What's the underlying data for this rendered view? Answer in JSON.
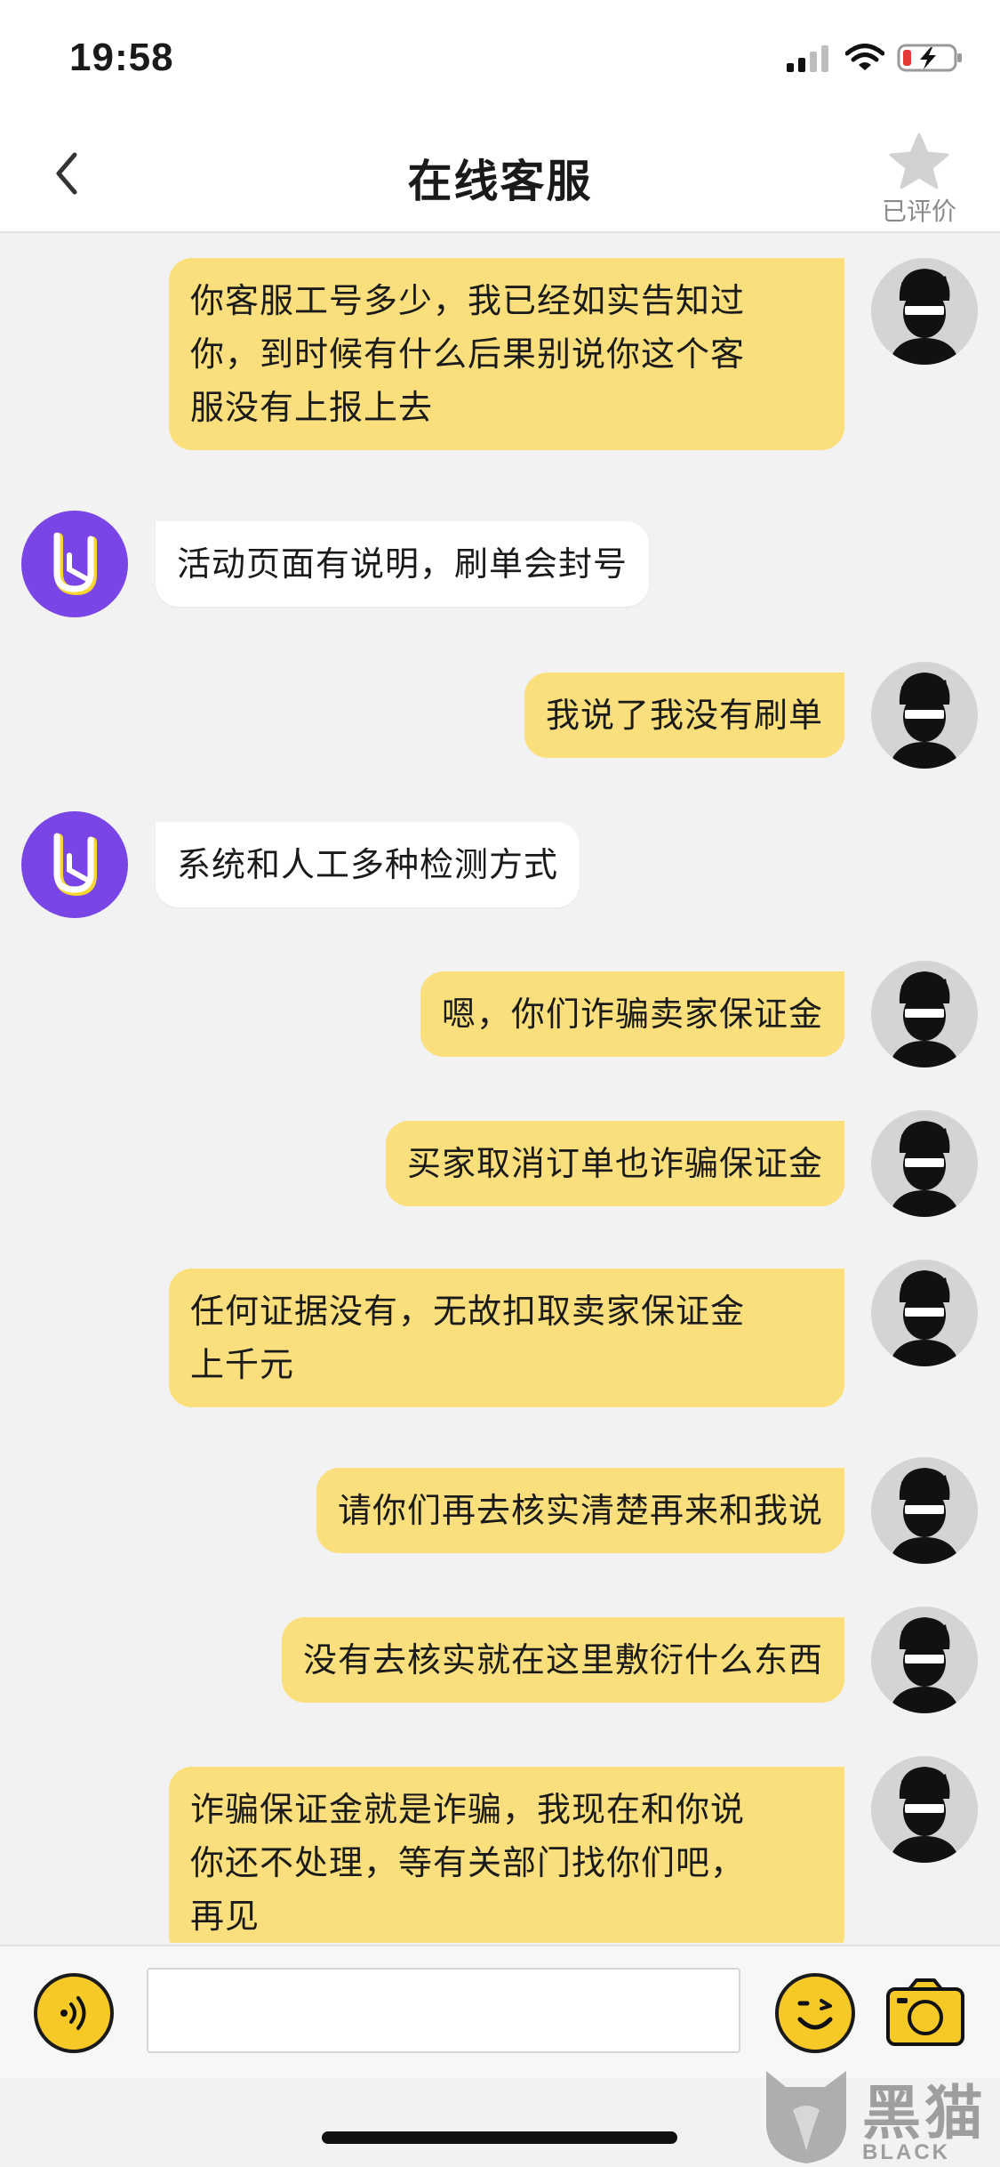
{
  "status_bar": {
    "time": "19:58"
  },
  "nav": {
    "title": "在线客服",
    "rate_label": "已评价"
  },
  "messages": [
    {
      "sender": "user",
      "text": "你客服工号多少，我已经如实告知过\n你，到时候有什么后果别说你这个客\n服没有上报上去"
    },
    {
      "sender": "agent",
      "text": "活动页面有说明，刷单会封号"
    },
    {
      "sender": "user",
      "text": "我说了我没有刷单"
    },
    {
      "sender": "agent",
      "text": "系统和人工多种检测方式"
    },
    {
      "sender": "user",
      "text": "嗯，你们诈骗卖家保证金"
    },
    {
      "sender": "user",
      "text": "买家取消订单也诈骗保证金"
    },
    {
      "sender": "user",
      "text": "任何证据没有，无故扣取卖家保证金\n上千元"
    },
    {
      "sender": "user",
      "text": "请你们再去核实清楚再来和我说"
    },
    {
      "sender": "user",
      "text": "没有去核实就在这里敷衍什么东西"
    },
    {
      "sender": "user",
      "text": "诈骗保证金就是诈骗，我现在和你说\n你还不处理，等有关部门找你们吧，\n再见"
    }
  ],
  "input": {
    "value": "",
    "placeholder": ""
  },
  "watermark": {
    "main": "黑猫",
    "sub": "BLACK CAT"
  },
  "colors": {
    "user_bubble": "#fadf7c",
    "agent_bubble": "#ffffff",
    "agent_avatar": "#7a45e6",
    "accent": "#f6c927"
  },
  "icons": [
    "back-icon",
    "star-icon",
    "voice-icon",
    "emoji-icon",
    "camera-icon",
    "user-avatar-icon",
    "agent-avatar-icon"
  ]
}
